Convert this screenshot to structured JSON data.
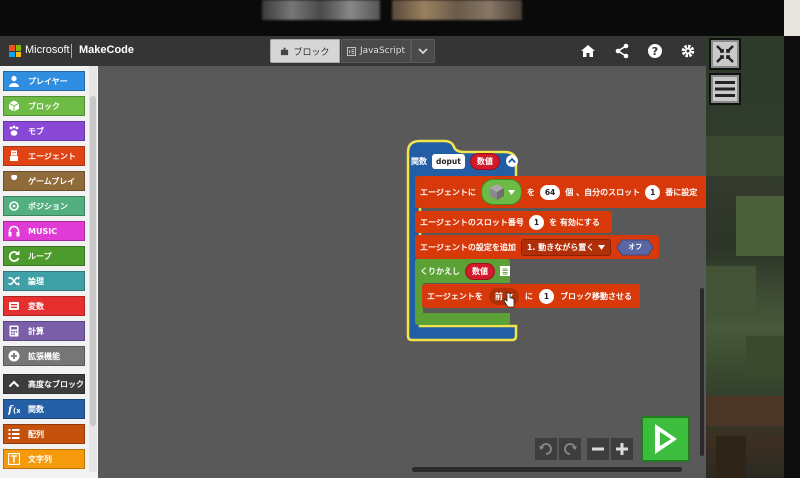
{
  "brand": {
    "company": "Microsoft",
    "product": "MakeCode"
  },
  "editor_tabs": {
    "blocks": "ブロック",
    "javascript": "JavaScript"
  },
  "header_icons": [
    "home-icon",
    "share-icon",
    "help-icon",
    "gear-icon"
  ],
  "overlay_buttons": [
    "collapse-icon",
    "menu-icon"
  ],
  "toolbox": {
    "categories": [
      {
        "label": "プレイヤー",
        "color": "#2f8ee0",
        "icon": "person-icon"
      },
      {
        "label": "ブロック",
        "color": "#6dbb45",
        "icon": "cube-icon"
      },
      {
        "label": "モブ",
        "color": "#8a48d6",
        "icon": "paw-icon"
      },
      {
        "label": "エージェント",
        "color": "#e04414",
        "icon": "agent-icon"
      },
      {
        "label": "ゲームプレイ",
        "color": "#8f6a3a",
        "icon": "wrench-icon"
      },
      {
        "label": "ポジション",
        "color": "#53ae80",
        "icon": "crosshair-icon"
      },
      {
        "label": "MUSIC",
        "color": "#e03bd4",
        "icon": "headphones-icon"
      },
      {
        "label": "ループ",
        "color": "#4d9a2d",
        "icon": "loop-icon"
      },
      {
        "label": "論理",
        "color": "#40a0a8",
        "icon": "shuffle-icon"
      },
      {
        "label": "変数",
        "color": "#e63030",
        "icon": "variable-icon"
      },
      {
        "label": "計算",
        "color": "#7b5ea8",
        "icon": "calculator-icon"
      },
      {
        "label": "拡張機能",
        "color": "#767676",
        "icon": "plus-circle-icon"
      },
      {
        "label": "高度なブロック",
        "color": "#3c3c3c",
        "icon": "chevron-up-icon"
      },
      {
        "label": "関数",
        "color": "#245ea5",
        "icon": "function-icon"
      },
      {
        "label": "配列",
        "color": "#c4510c",
        "icon": "list-icon"
      },
      {
        "label": "文字列",
        "color": "#f49a0c",
        "icon": "text-icon"
      }
    ]
  },
  "workspace": {
    "function_block": {
      "keyword": "関数",
      "name": "doput",
      "param": "数値"
    },
    "agent_place": {
      "prefix": "エージェントに",
      "mid1": "を",
      "count": "64",
      "mid2": "個 、自分のスロット",
      "slot": "1",
      "suffix": "番に設定"
    },
    "agent_slot": {
      "prefix": "エージェントのスロット番号",
      "slot": "1",
      "suffix": "を 有効にする"
    },
    "agent_setting": {
      "prefix": "エージェントの設定を追加",
      "option": "1. 動きながら置く",
      "toggle": "オフ"
    },
    "repeat_block": {
      "keyword": "くりかえし",
      "param": "数値",
      "icon": "≣"
    },
    "agent_move": {
      "prefix": "エージェントを",
      "direction": "前",
      "mid": "に",
      "amount": "1",
      "suffix": "ブロック移動させる"
    }
  },
  "colors": {
    "header_bg": "#353535",
    "workspace_bg": "#595959",
    "function_blue": "#235ea5",
    "agent_orange": "#d8390b",
    "loop_green": "#5ca135",
    "highlight_yellow": "#f2e54a"
  }
}
